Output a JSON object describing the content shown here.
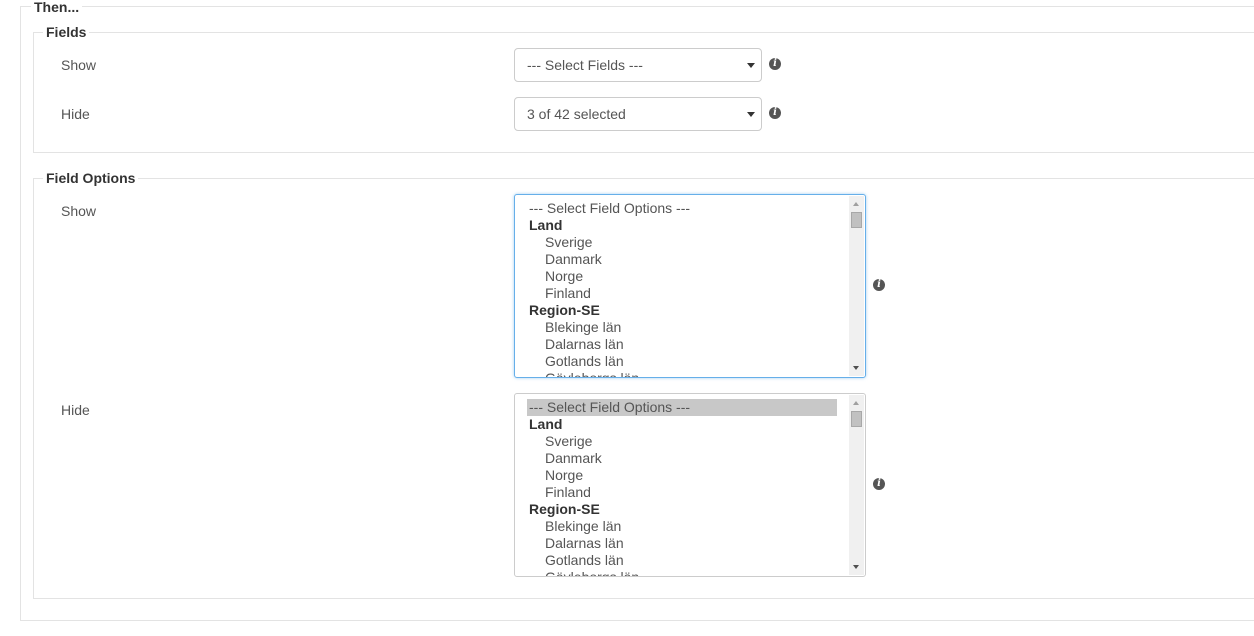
{
  "then": {
    "legend": "Then..."
  },
  "fields": {
    "legend": "Fields",
    "show": {
      "label": "Show",
      "value": "--- Select Fields ---"
    },
    "hide": {
      "label": "Hide",
      "value": "3 of 42 selected"
    }
  },
  "field_options": {
    "legend": "Field Options",
    "show": {
      "label": "Show",
      "options": [
        {
          "text": "--- Select Field Options ---",
          "kind": "option"
        },
        {
          "text": "Land",
          "kind": "group"
        },
        {
          "text": "Sverige",
          "kind": "child"
        },
        {
          "text": "Danmark",
          "kind": "child"
        },
        {
          "text": "Norge",
          "kind": "child"
        },
        {
          "text": "Finland",
          "kind": "child"
        },
        {
          "text": "Region-SE",
          "kind": "group"
        },
        {
          "text": "Blekinge län",
          "kind": "child"
        },
        {
          "text": "Dalarnas län",
          "kind": "child"
        },
        {
          "text": "Gotlands län",
          "kind": "child"
        },
        {
          "text": "Gävleborgs län",
          "kind": "child"
        }
      ]
    },
    "hide": {
      "label": "Hide",
      "options": [
        {
          "text": "--- Select Field Options ---",
          "kind": "option",
          "selected": true
        },
        {
          "text": "Land",
          "kind": "group"
        },
        {
          "text": "Sverige",
          "kind": "child"
        },
        {
          "text": "Danmark",
          "kind": "child"
        },
        {
          "text": "Norge",
          "kind": "child"
        },
        {
          "text": "Finland",
          "kind": "child"
        },
        {
          "text": "Region-SE",
          "kind": "group"
        },
        {
          "text": "Blekinge län",
          "kind": "child"
        },
        {
          "text": "Dalarnas län",
          "kind": "child"
        },
        {
          "text": "Gotlands län",
          "kind": "child"
        },
        {
          "text": "Gävleborgs län",
          "kind": "child"
        }
      ]
    }
  },
  "icons": {
    "info": "info-icon",
    "caret": "caret-down-icon",
    "scroll_up": "scroll-up-arrow-icon",
    "scroll_down": "scroll-down-arrow-icon"
  },
  "colors": {
    "focus_border": "#66afe9",
    "selected_option_bg": "#c8c8c8",
    "fieldset_border": "#e3e3e3"
  }
}
